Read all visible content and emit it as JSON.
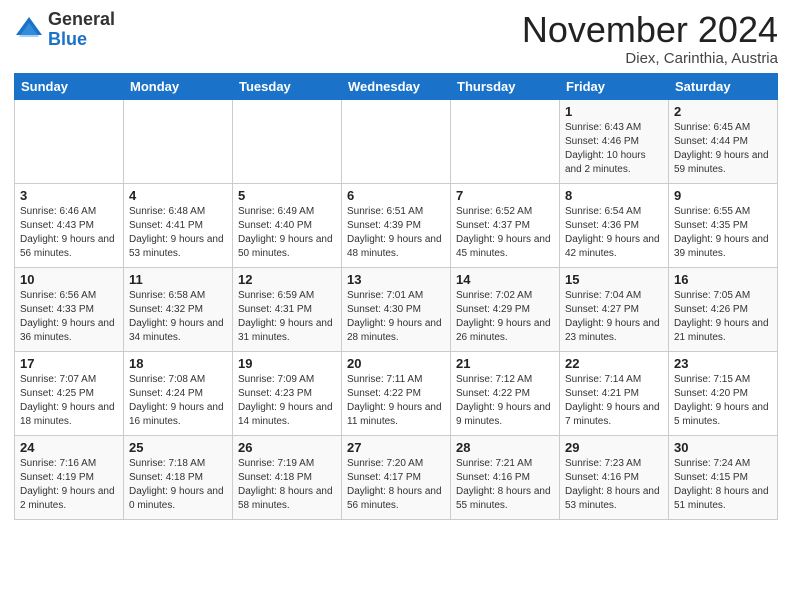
{
  "logo": {
    "general": "General",
    "blue": "Blue"
  },
  "header": {
    "month_title": "November 2024",
    "location": "Diex, Carinthia, Austria"
  },
  "days_of_week": [
    "Sunday",
    "Monday",
    "Tuesday",
    "Wednesday",
    "Thursday",
    "Friday",
    "Saturday"
  ],
  "weeks": [
    [
      {
        "day": "",
        "info": ""
      },
      {
        "day": "",
        "info": ""
      },
      {
        "day": "",
        "info": ""
      },
      {
        "day": "",
        "info": ""
      },
      {
        "day": "",
        "info": ""
      },
      {
        "day": "1",
        "info": "Sunrise: 6:43 AM\nSunset: 4:46 PM\nDaylight: 10 hours and 2 minutes."
      },
      {
        "day": "2",
        "info": "Sunrise: 6:45 AM\nSunset: 4:44 PM\nDaylight: 9 hours and 59 minutes."
      }
    ],
    [
      {
        "day": "3",
        "info": "Sunrise: 6:46 AM\nSunset: 4:43 PM\nDaylight: 9 hours and 56 minutes."
      },
      {
        "day": "4",
        "info": "Sunrise: 6:48 AM\nSunset: 4:41 PM\nDaylight: 9 hours and 53 minutes."
      },
      {
        "day": "5",
        "info": "Sunrise: 6:49 AM\nSunset: 4:40 PM\nDaylight: 9 hours and 50 minutes."
      },
      {
        "day": "6",
        "info": "Sunrise: 6:51 AM\nSunset: 4:39 PM\nDaylight: 9 hours and 48 minutes."
      },
      {
        "day": "7",
        "info": "Sunrise: 6:52 AM\nSunset: 4:37 PM\nDaylight: 9 hours and 45 minutes."
      },
      {
        "day": "8",
        "info": "Sunrise: 6:54 AM\nSunset: 4:36 PM\nDaylight: 9 hours and 42 minutes."
      },
      {
        "day": "9",
        "info": "Sunrise: 6:55 AM\nSunset: 4:35 PM\nDaylight: 9 hours and 39 minutes."
      }
    ],
    [
      {
        "day": "10",
        "info": "Sunrise: 6:56 AM\nSunset: 4:33 PM\nDaylight: 9 hours and 36 minutes."
      },
      {
        "day": "11",
        "info": "Sunrise: 6:58 AM\nSunset: 4:32 PM\nDaylight: 9 hours and 34 minutes."
      },
      {
        "day": "12",
        "info": "Sunrise: 6:59 AM\nSunset: 4:31 PM\nDaylight: 9 hours and 31 minutes."
      },
      {
        "day": "13",
        "info": "Sunrise: 7:01 AM\nSunset: 4:30 PM\nDaylight: 9 hours and 28 minutes."
      },
      {
        "day": "14",
        "info": "Sunrise: 7:02 AM\nSunset: 4:29 PM\nDaylight: 9 hours and 26 minutes."
      },
      {
        "day": "15",
        "info": "Sunrise: 7:04 AM\nSunset: 4:27 PM\nDaylight: 9 hours and 23 minutes."
      },
      {
        "day": "16",
        "info": "Sunrise: 7:05 AM\nSunset: 4:26 PM\nDaylight: 9 hours and 21 minutes."
      }
    ],
    [
      {
        "day": "17",
        "info": "Sunrise: 7:07 AM\nSunset: 4:25 PM\nDaylight: 9 hours and 18 minutes."
      },
      {
        "day": "18",
        "info": "Sunrise: 7:08 AM\nSunset: 4:24 PM\nDaylight: 9 hours and 16 minutes."
      },
      {
        "day": "19",
        "info": "Sunrise: 7:09 AM\nSunset: 4:23 PM\nDaylight: 9 hours and 14 minutes."
      },
      {
        "day": "20",
        "info": "Sunrise: 7:11 AM\nSunset: 4:22 PM\nDaylight: 9 hours and 11 minutes."
      },
      {
        "day": "21",
        "info": "Sunrise: 7:12 AM\nSunset: 4:22 PM\nDaylight: 9 hours and 9 minutes."
      },
      {
        "day": "22",
        "info": "Sunrise: 7:14 AM\nSunset: 4:21 PM\nDaylight: 9 hours and 7 minutes."
      },
      {
        "day": "23",
        "info": "Sunrise: 7:15 AM\nSunset: 4:20 PM\nDaylight: 9 hours and 5 minutes."
      }
    ],
    [
      {
        "day": "24",
        "info": "Sunrise: 7:16 AM\nSunset: 4:19 PM\nDaylight: 9 hours and 2 minutes."
      },
      {
        "day": "25",
        "info": "Sunrise: 7:18 AM\nSunset: 4:18 PM\nDaylight: 9 hours and 0 minutes."
      },
      {
        "day": "26",
        "info": "Sunrise: 7:19 AM\nSunset: 4:18 PM\nDaylight: 8 hours and 58 minutes."
      },
      {
        "day": "27",
        "info": "Sunrise: 7:20 AM\nSunset: 4:17 PM\nDaylight: 8 hours and 56 minutes."
      },
      {
        "day": "28",
        "info": "Sunrise: 7:21 AM\nSunset: 4:16 PM\nDaylight: 8 hours and 55 minutes."
      },
      {
        "day": "29",
        "info": "Sunrise: 7:23 AM\nSunset: 4:16 PM\nDaylight: 8 hours and 53 minutes."
      },
      {
        "day": "30",
        "info": "Sunrise: 7:24 AM\nSunset: 4:15 PM\nDaylight: 8 hours and 51 minutes."
      }
    ]
  ]
}
